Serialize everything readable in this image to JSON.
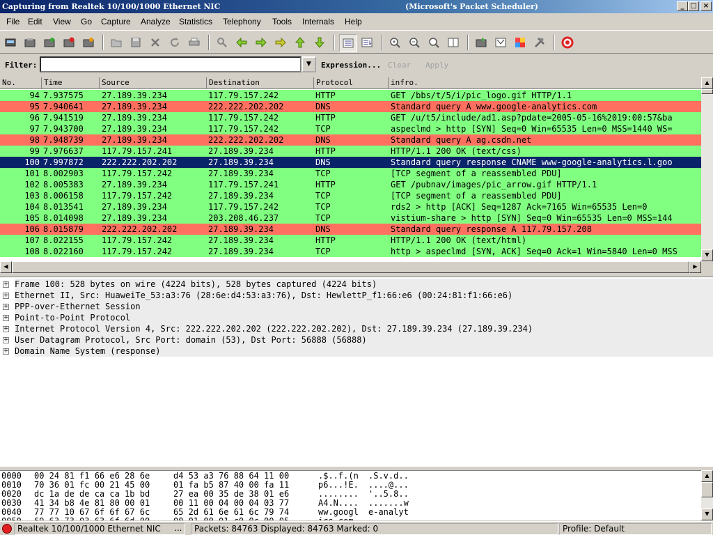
{
  "window": {
    "title": "Capturing from Realtek 10/100/1000 Ethernet NIC",
    "title_right": "(Microsoft's Packet Scheduler)",
    "controls": {
      "minimize": "_",
      "maximize": "□",
      "close": "×"
    }
  },
  "menu": [
    "File",
    "Edit",
    "View",
    "Go",
    "Capture",
    "Analyze",
    "Statistics",
    "Telephony",
    "Tools",
    "Internals",
    "Help"
  ],
  "toolbar": {
    "icons": [
      "interfaces-icon",
      "options-icon",
      "start-icon",
      "stop-icon",
      "restart-icon",
      "open-icon",
      "save-icon",
      "close-file-icon",
      "reload-icon",
      "print-icon",
      "find-icon",
      "back-icon",
      "forward-icon",
      "goto-icon",
      "first-icon",
      "last-icon",
      "colorize-icon",
      "autoscroll-icon",
      "zoom-in-icon",
      "zoom-out-icon",
      "zoom-normal-icon",
      "resize-columns-icon",
      "capture-filters-icon",
      "display-filters-icon",
      "coloring-rules-icon",
      "preferences-icon",
      "help-icon"
    ]
  },
  "filter": {
    "label": "Filter:",
    "value": "",
    "expression": "Expression...",
    "clear": "Clear",
    "apply": "Apply"
  },
  "colors": {
    "http_tcp": "#80ff80",
    "dns": "#ff7060",
    "selected": "#0a246a"
  },
  "packet_list": {
    "columns": [
      "No.",
      "Time",
      "Source",
      "Destination",
      "Protocol",
      "infro."
    ],
    "rows": [
      {
        "no": "94",
        "time": "7.937575",
        "src": "27.189.39.234",
        "dst": "117.79.157.242",
        "proto": "HTTP",
        "info": "GET /bbs/t/5/i/pic_logo.gif HTTP/1.1",
        "type": "green"
      },
      {
        "no": "95",
        "time": "7.940641",
        "src": "27.189.39.234",
        "dst": "222.222.202.202",
        "proto": "DNS",
        "info": "Standard query A www.google-analytics.com",
        "type": "red"
      },
      {
        "no": "96",
        "time": "7.941519",
        "src": "27.189.39.234",
        "dst": "117.79.157.242",
        "proto": "HTTP",
        "info": "GET /u/t5/include/ad1.asp?pdate=2005-05-16%2019:00:57&ba",
        "type": "green"
      },
      {
        "no": "97",
        "time": "7.943700",
        "src": "27.189.39.234",
        "dst": "117.79.157.242",
        "proto": "TCP",
        "info": "aspeclmd > http [SYN] Seq=0 Win=65535 Len=0 MSS=1440 WS=",
        "type": "green"
      },
      {
        "no": "98",
        "time": "7.948739",
        "src": "27.189.39.234",
        "dst": "222.222.202.202",
        "proto": "DNS",
        "info": "Standard query A ag.csdn.net",
        "type": "red"
      },
      {
        "no": "99",
        "time": "7.976637",
        "src": "117.79.157.241",
        "dst": "27.189.39.234",
        "proto": "HTTP",
        "info": "HTTP/1.1 200 OK  (text/css)",
        "type": "green"
      },
      {
        "no": "100",
        "time": "7.997872",
        "src": "222.222.202.202",
        "dst": "27.189.39.234",
        "proto": "DNS",
        "info": "Standard query response CNAME www-google-analytics.l.goo",
        "type": "selected"
      },
      {
        "no": "101",
        "time": "8.002903",
        "src": "117.79.157.242",
        "dst": "27.189.39.234",
        "proto": "TCP",
        "info": "[TCP segment of a reassembled PDU]",
        "type": "green"
      },
      {
        "no": "102",
        "time": "8.005383",
        "src": "27.189.39.234",
        "dst": "117.79.157.241",
        "proto": "HTTP",
        "info": "GET /pubnav/images/pic_arrow.gif HTTP/1.1",
        "type": "green"
      },
      {
        "no": "103",
        "time": "8.006158",
        "src": "117.79.157.242",
        "dst": "27.189.39.234",
        "proto": "TCP",
        "info": "[TCP segment of a reassembled PDU]",
        "type": "green"
      },
      {
        "no": "104",
        "time": "8.013541",
        "src": "27.189.39.234",
        "dst": "117.79.157.242",
        "proto": "TCP",
        "info": "rds2 > http [ACK] Seq=1287 Ack=7165 Win=65535 Len=0",
        "type": "green"
      },
      {
        "no": "105",
        "time": "8.014098",
        "src": "27.189.39.234",
        "dst": "203.208.46.237",
        "proto": "TCP",
        "info": "vistium-share > http [SYN] Seq=0 Win=65535 Len=0 MSS=144",
        "type": "green"
      },
      {
        "no": "106",
        "time": "8.015879",
        "src": "222.222.202.202",
        "dst": "27.189.39.234",
        "proto": "DNS",
        "info": "Standard query response A 117.79.157.208",
        "type": "red"
      },
      {
        "no": "107",
        "time": "8.022155",
        "src": "117.79.157.242",
        "dst": "27.189.39.234",
        "proto": "HTTP",
        "info": "HTTP/1.1 200 OK  (text/html)",
        "type": "green"
      },
      {
        "no": "108",
        "time": "8.022160",
        "src": "117.79.157.242",
        "dst": "27.189.39.234",
        "proto": "TCP",
        "info": "http > aspeclmd [SYN, ACK] Seq=0 Ack=1 Win=5840 Len=0 MSS",
        "type": "green"
      }
    ]
  },
  "details": [
    "Frame 100: 528 bytes on wire (4224 bits), 528 bytes captured (4224 bits)",
    "Ethernet II, Src: HuaweiTe_53:a3:76 (28:6e:d4:53:a3:76), Dst: HewlettP_f1:66:e6 (00:24:81:f1:66:e6)",
    "PPP-over-Ethernet Session",
    "Point-to-Point Protocol",
    "Internet Protocol Version 4, Src: 222.222.202.202 (222.222.202.202), Dst: 27.189.39.234 (27.189.39.234)",
    "User Datagram Protocol, Src Port: domain (53), Dst Port: 56888 (56888)",
    "Domain Name System (response)"
  ],
  "hex": [
    {
      "off": "0000",
      "b1": "00 24 81 f1 66 e6 28 6e",
      "b2": "d4 53 a3 76 88 64 11 00",
      "a1": ".$..f.(n",
      "a2": ".S.v.d.."
    },
    {
      "off": "0010",
      "b1": "70 36 01 fc 00 21 45 00",
      "b2": "01 fa b5 87 40 00 fa 11",
      "a1": "p6...!E.",
      "a2": "....@..."
    },
    {
      "off": "0020",
      "b1": "dc 1a de de ca ca 1b bd",
      "b2": "27 ea 00 35 de 38 01 e6",
      "a1": "........",
      "a2": "'..5.8.."
    },
    {
      "off": "0030",
      "b1": "41 34 b8 4e 81 80 00 01",
      "b2": "00 11 00 04 00 04 03 77",
      "a1": "A4.N....",
      "a2": ".......w"
    },
    {
      "off": "0040",
      "b1": "77 77 10 67 6f 6f 67 6c",
      "b2": "65 2d 61 6e 61 6c 79 74",
      "a1": "ww.googl",
      "a2": "e-analyt"
    },
    {
      "off": "0050",
      "b1": "69 63 73 03 63 6f 6d 00",
      "b2": "00 01 00 01 c0 0c 00 05",
      "a1": "ics.com.",
      "a2": "........"
    }
  ],
  "status": {
    "interface": "Realtek 10/100/1000 Ethernet NIC",
    "ellipsis": "...",
    "packets": "Packets: 84763 Displayed: 84763 Marked: 0",
    "profile": "Profile: Default"
  }
}
